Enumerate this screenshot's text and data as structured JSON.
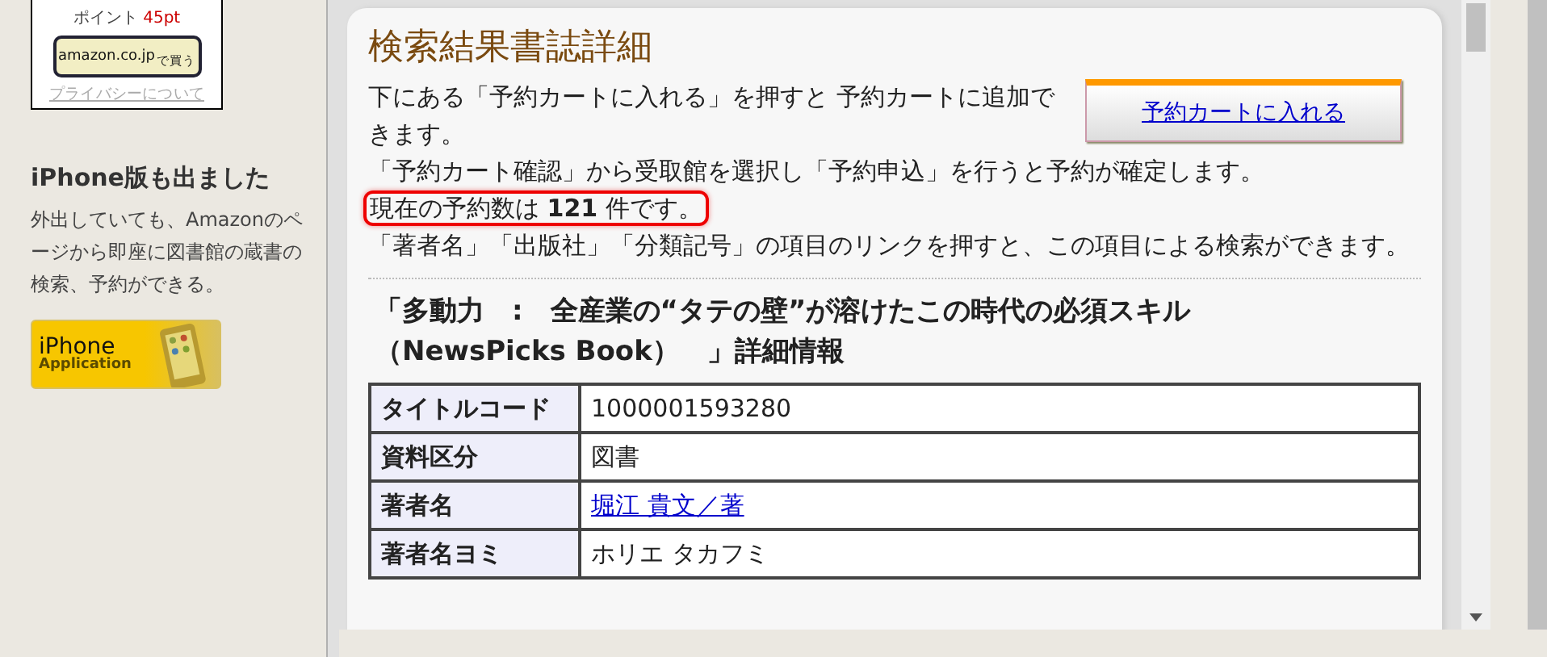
{
  "sidebar": {
    "points": {
      "label": "ポイント",
      "value": "45pt"
    },
    "amazon_button": {
      "brand": "amazon.co.jp",
      "action": "で買う"
    },
    "privacy_link": "プライバシーについて",
    "promo": {
      "heading": "iPhone版も出ました",
      "text": "外出していても、Amazonのページから即座に図書館の蔵書の検索、予約ができる。",
      "badge": {
        "title": "iPhone",
        "subtitle": "Application"
      }
    }
  },
  "main": {
    "title": "検索結果書誌詳細",
    "cart_button": "予約カートに入れる",
    "paragraphs": [
      {
        "text": "下にある「予約カートに入れる」を押すと 予約カートに追加できます。",
        "highlighted": false
      },
      {
        "text": "「予約カート確認」から受取館を選択し「予約申込」を行うと予約が確定します。",
        "highlighted": false
      },
      {
        "text": "現在の予約数は **121** 件です。",
        "highlighted": true
      },
      {
        "text": "「著者名」「出版社」「分類記号」の項目のリンクを押すと、この項目による検索ができます。",
        "highlighted": false
      }
    ],
    "book_heading": "「多動力　:　全産業の“タテの壁”が溶けたこの時代の必須スキル（NewsPicks Book）　」詳細情報",
    "table": {
      "rows": [
        {
          "label": "タイトルコード",
          "value": "1000001593280",
          "kind": "text"
        },
        {
          "label": "資料区分",
          "value": "図書",
          "kind": "text"
        },
        {
          "label": "著者名",
          "value": "堀江 貴文／著",
          "kind": "link"
        },
        {
          "label": "著者名ヨミ",
          "value": "ホリエ タカフミ",
          "kind": "text"
        }
      ]
    }
  }
}
